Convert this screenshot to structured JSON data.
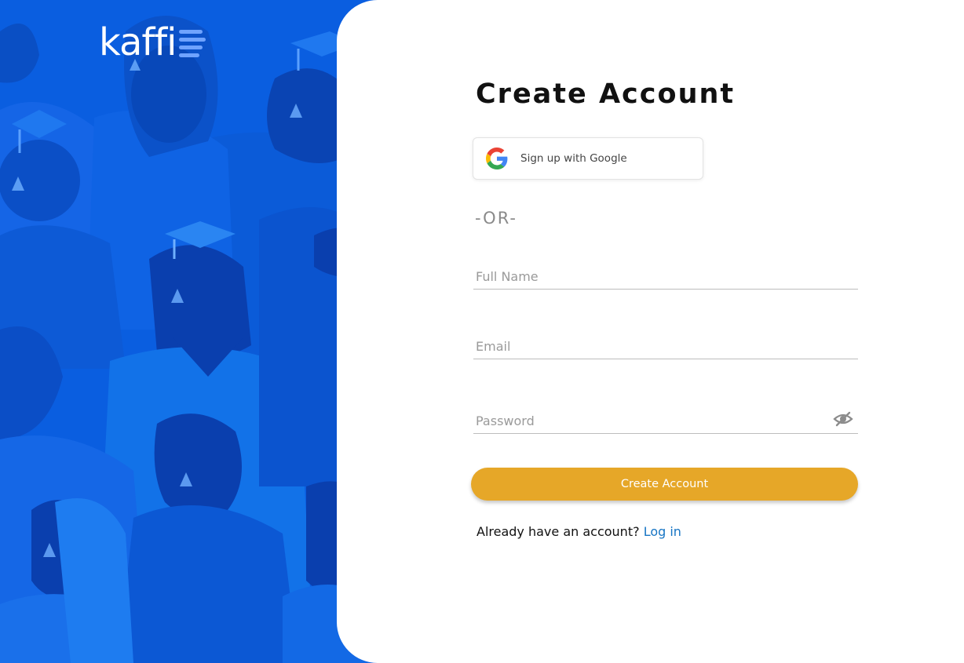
{
  "brand": {
    "logo_text": "kaffi"
  },
  "illustration": {
    "description_icon": "students-crowd-illustration"
  },
  "form": {
    "title": "Create Account",
    "google_button_label": "Sign up with Google",
    "divider": "-OR-",
    "full_name_placeholder": "Full Name",
    "email_placeholder": "Email",
    "password_placeholder": "Password",
    "password_toggle_icon": "eye-slash-icon",
    "submit_label": "Create Account",
    "login_prompt": "Already have an account?",
    "login_link": "Log in"
  },
  "colors": {
    "accent": "#e6a728",
    "link": "#1775c4",
    "panel_blue": "#0a5ee0"
  }
}
